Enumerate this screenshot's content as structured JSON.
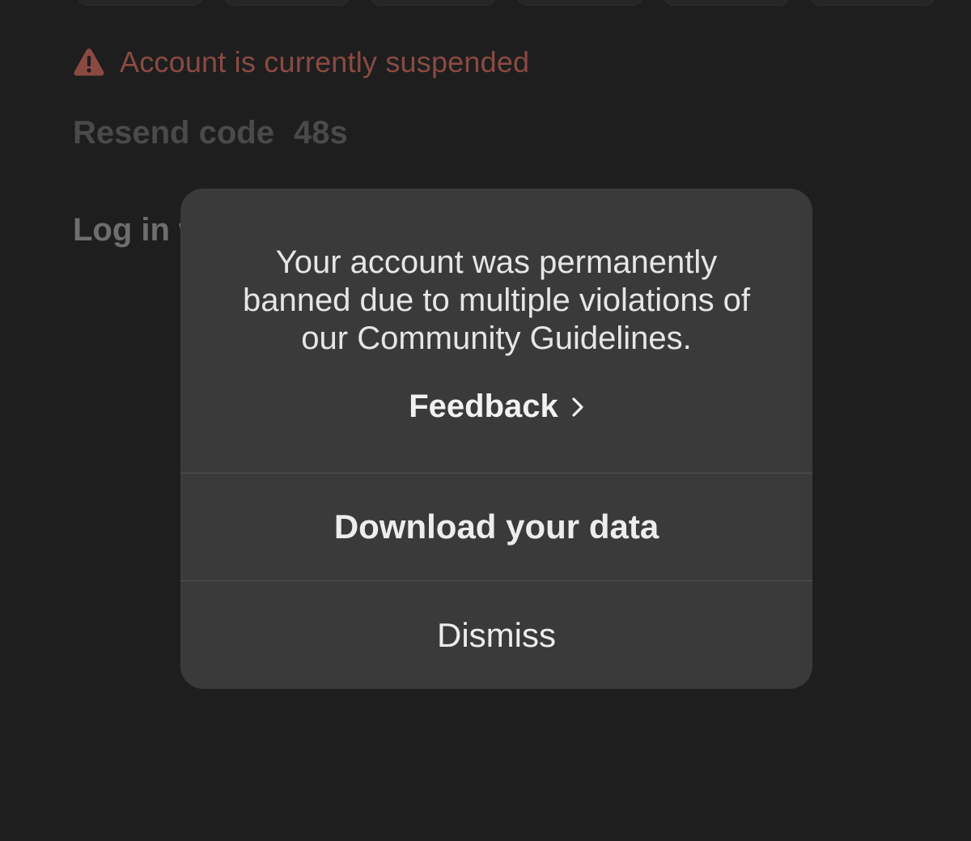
{
  "warning": {
    "icon": "warning-triangle-icon",
    "text": "Account is currently suspended",
    "color": "#8a4a42"
  },
  "resend": {
    "label": "Resend code",
    "countdown": "48s"
  },
  "login": {
    "label": "Log in w"
  },
  "modal": {
    "message": "Your account was permanently banned due to multiple violations of our Community Guidelines.",
    "feedback_label": "Feedback",
    "feedback_icon": "chevron-right-icon",
    "actions": [
      {
        "label": "Download your data"
      },
      {
        "label": "Dismiss"
      }
    ]
  },
  "colors": {
    "background": "#1e1e1e",
    "modal_background": "#3a3a3a",
    "warning": "#8a4a42"
  }
}
